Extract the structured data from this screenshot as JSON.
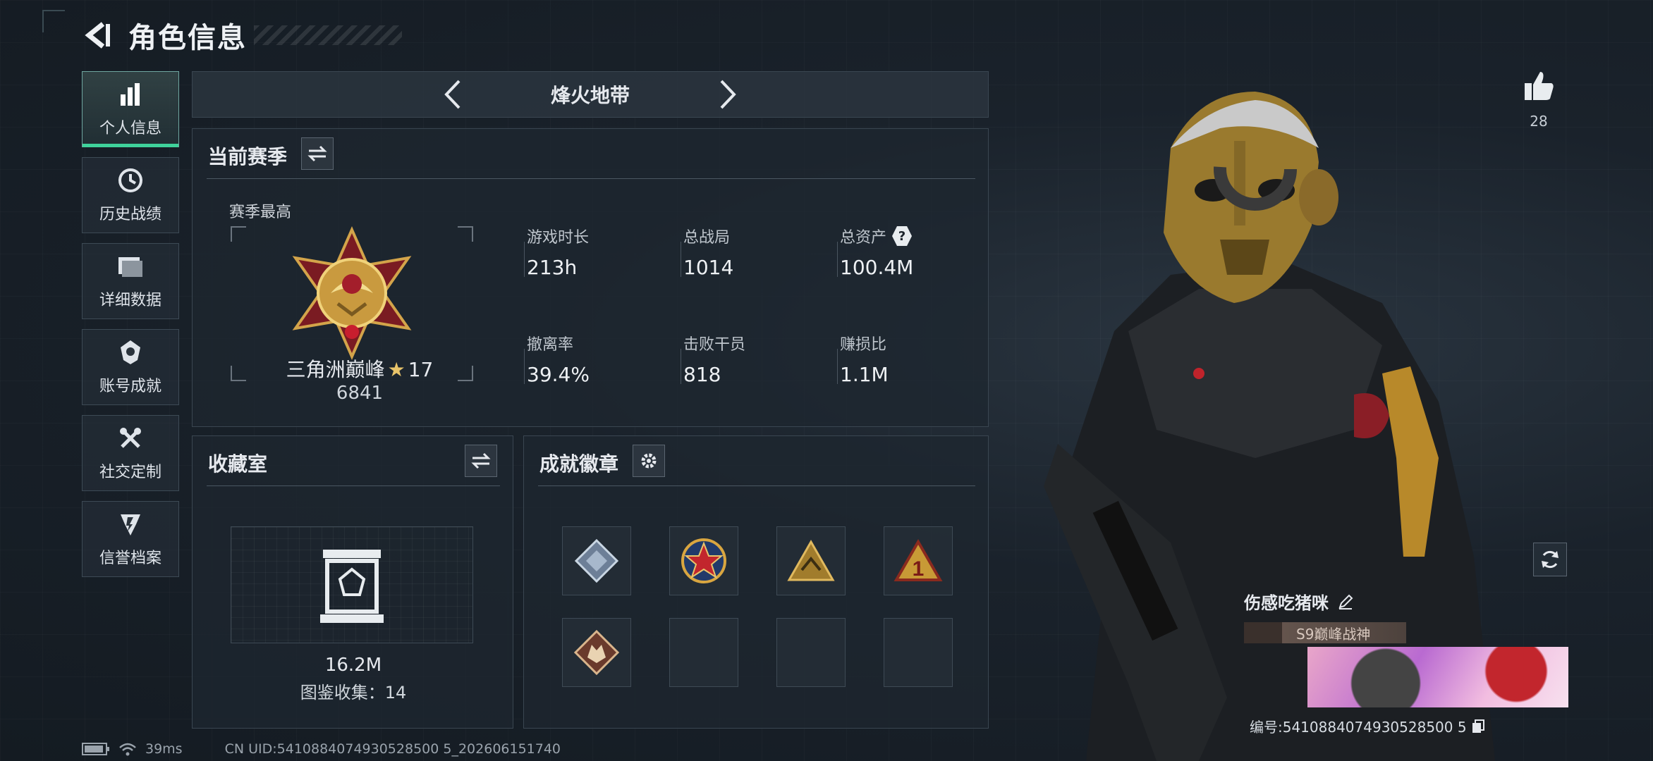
{
  "header": {
    "title": "角色信息"
  },
  "sidebar": {
    "items": [
      {
        "label": "个人信息",
        "icon": "bar-chart-icon",
        "active": true
      },
      {
        "label": "历史战绩",
        "icon": "history-icon",
        "active": false
      },
      {
        "label": "详细数据",
        "icon": "folder-icon",
        "active": false
      },
      {
        "label": "账号成就",
        "icon": "achievement-icon",
        "active": false
      },
      {
        "label": "社交定制",
        "icon": "tools-icon",
        "active": false
      },
      {
        "label": "信誉档案",
        "icon": "shield-icon",
        "active": false
      }
    ]
  },
  "mode": {
    "title": "烽火地带"
  },
  "season": {
    "title": "当前赛季",
    "best_label": "赛季最高",
    "rank_name": "三角洲巅峰",
    "rank_stars": "17",
    "rank_score": "6841",
    "stats": [
      {
        "label": "游戏时长",
        "value": "213h"
      },
      {
        "label": "总战局",
        "value": "1014"
      },
      {
        "label": "总资产",
        "value": "100.4M",
        "help": "?"
      },
      {
        "label": "撤离率",
        "value": "39.4%"
      },
      {
        "label": "击败干员",
        "value": "818"
      },
      {
        "label": "赚损比",
        "value": "1.1M"
      }
    ]
  },
  "collection": {
    "title": "收藏室",
    "value": "16.2M",
    "count_text": "图鉴收集：14"
  },
  "badges": {
    "title": "成就徽章",
    "slots": [
      "badge-diamond",
      "badge-star",
      "badge-pyramid",
      "badge-number-one",
      "badge-wolf",
      "",
      "",
      ""
    ]
  },
  "like": {
    "count": "28"
  },
  "player": {
    "name": "伤感吃猪咪",
    "title": "S9巅峰战神",
    "uid_text": "编号:5410884074930528500 5"
  },
  "status": {
    "ping": "39ms",
    "uid": "CN UID:5410884074930528500 5_202606151740"
  },
  "colors": {
    "accent": "#3fd29b",
    "gold": "#e8c46a",
    "panel": "#1e262f"
  }
}
